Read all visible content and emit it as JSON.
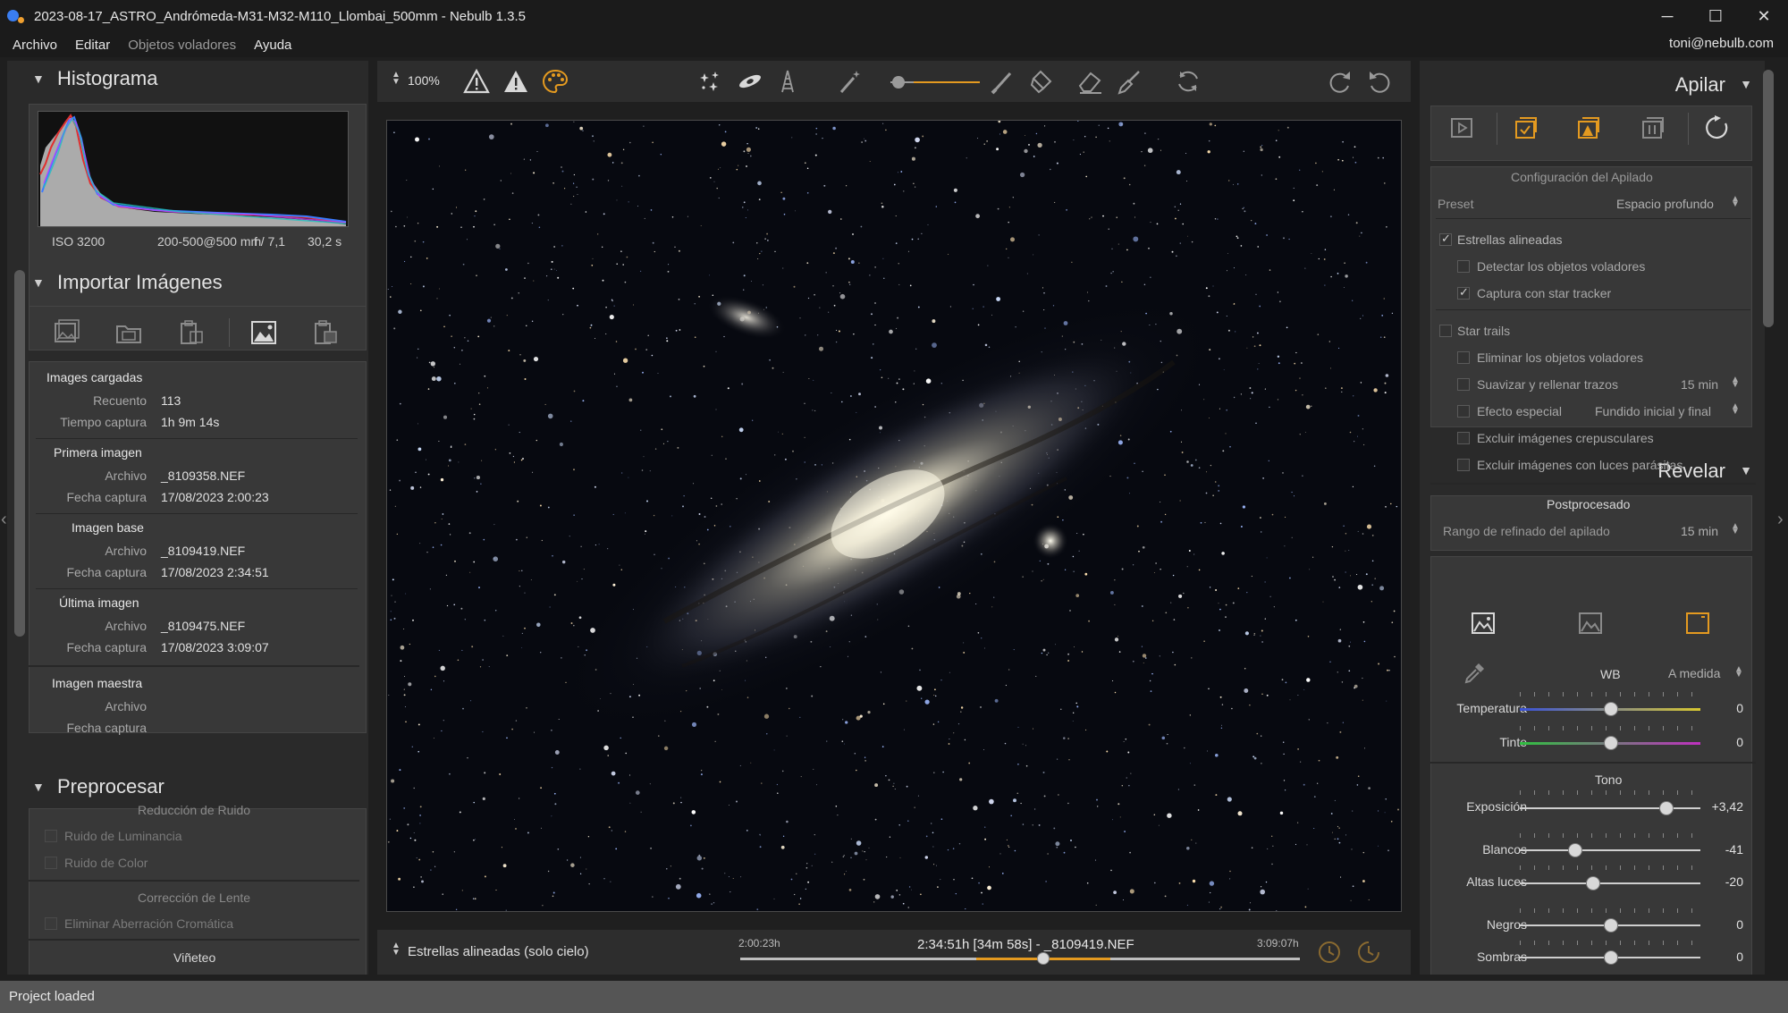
{
  "window": {
    "title": "2023-08-17_ASTRO_Andrómeda-M31-M32-M110_Llombai_500mm - Nebulb 1.3.5",
    "minimize": "─",
    "maximize": "☐",
    "close": "✕"
  },
  "menu": {
    "items": [
      "Archivo",
      "Editar",
      "Objetos voladores",
      "Ayuda"
    ],
    "user": "toni@nebulb.com"
  },
  "histogram": {
    "title": "Histograma",
    "iso": "ISO 3200",
    "lens": "200-500@500 mm",
    "aperture": "f / 7,1",
    "exposure": "30,2 s"
  },
  "import": {
    "title": "Importar Imágenes",
    "loaded": {
      "title": "Images cargadas",
      "count_label": "Recuento",
      "count": "113",
      "time_label": "Tiempo captura",
      "time": "1h 9m 14s"
    },
    "first": {
      "title": "Primera imagen",
      "file_label": "Archivo",
      "file": "_8109358.NEF",
      "date_label": "Fecha captura",
      "date": "17/08/2023 2:00:23"
    },
    "base": {
      "title": "Imagen base",
      "file_label": "Archivo",
      "file": "_8109419.NEF",
      "date_label": "Fecha captura",
      "date": "17/08/2023 2:34:51"
    },
    "last": {
      "title": "Última imagen",
      "file_label": "Archivo",
      "file": "_8109475.NEF",
      "date_label": "Fecha captura",
      "date": "17/08/2023 3:09:07"
    },
    "master": {
      "title": "Imagen maestra",
      "file_label": "Archivo",
      "date_label": "Fecha captura"
    }
  },
  "preprocess": {
    "title": "Preprocesar",
    "noise_title": "Reducción de Ruido",
    "luminance": "Ruido de Luminancia",
    "color": "Ruido de Color",
    "lens_title": "Corrección de Lente",
    "chromatic": "Eliminar Aberración Cromática",
    "vignette": "Viñeteo"
  },
  "toolbar": {
    "zoom": "100%"
  },
  "timeline": {
    "mode": "Estrellas alineadas (solo cielo)",
    "start": "2:00:23h",
    "current": "2:34:51h [34m 58s] - _8109419.NEF",
    "end": "3:09:07h"
  },
  "stack": {
    "title": "Apilar",
    "config_title": "Configuración del Apilado",
    "preset_label": "Preset",
    "preset_value": "Espacio profundo",
    "aligned": "Estrellas alineadas",
    "detect": "Detectar los objetos voladores",
    "tracker": "Captura con star tracker",
    "trails": "Star trails",
    "remove": "Eliminar los objetos voladores",
    "smooth": "Suavizar y rellenar trazos",
    "smooth_value": "15 min",
    "effect": "Efecto especial",
    "effect_value": "Fundido inicial y final",
    "twilight": "Excluir imágenes crepusculares",
    "parasitic": "Excluir imágenes con luces parásitas",
    "post_title": "Postprocesado",
    "refine_label": "Rango de refinado del apilado",
    "refine_value": "15 min"
  },
  "develop": {
    "title": "Revelar",
    "wb_label": "WB",
    "wb_value": "A medida",
    "temp_label": "Temperatura",
    "temp_value": "0",
    "tint_label": "Tinte",
    "tint_value": "0",
    "tone_title": "Tono",
    "exposure_label": "Exposición",
    "exposure_value": "+3,42",
    "whites_label": "Blancos",
    "whites_value": "-41",
    "highlights_label": "Altas luces",
    "highlights_value": "-20",
    "blacks_label": "Negros",
    "blacks_value": "0",
    "shadows_label": "Sombras",
    "shadows_value": "0"
  },
  "status": {
    "text": "Project loaded"
  },
  "colors": {
    "accent": "#e49a20",
    "panel": "#2a2a2a",
    "subpanel": "#383838"
  }
}
